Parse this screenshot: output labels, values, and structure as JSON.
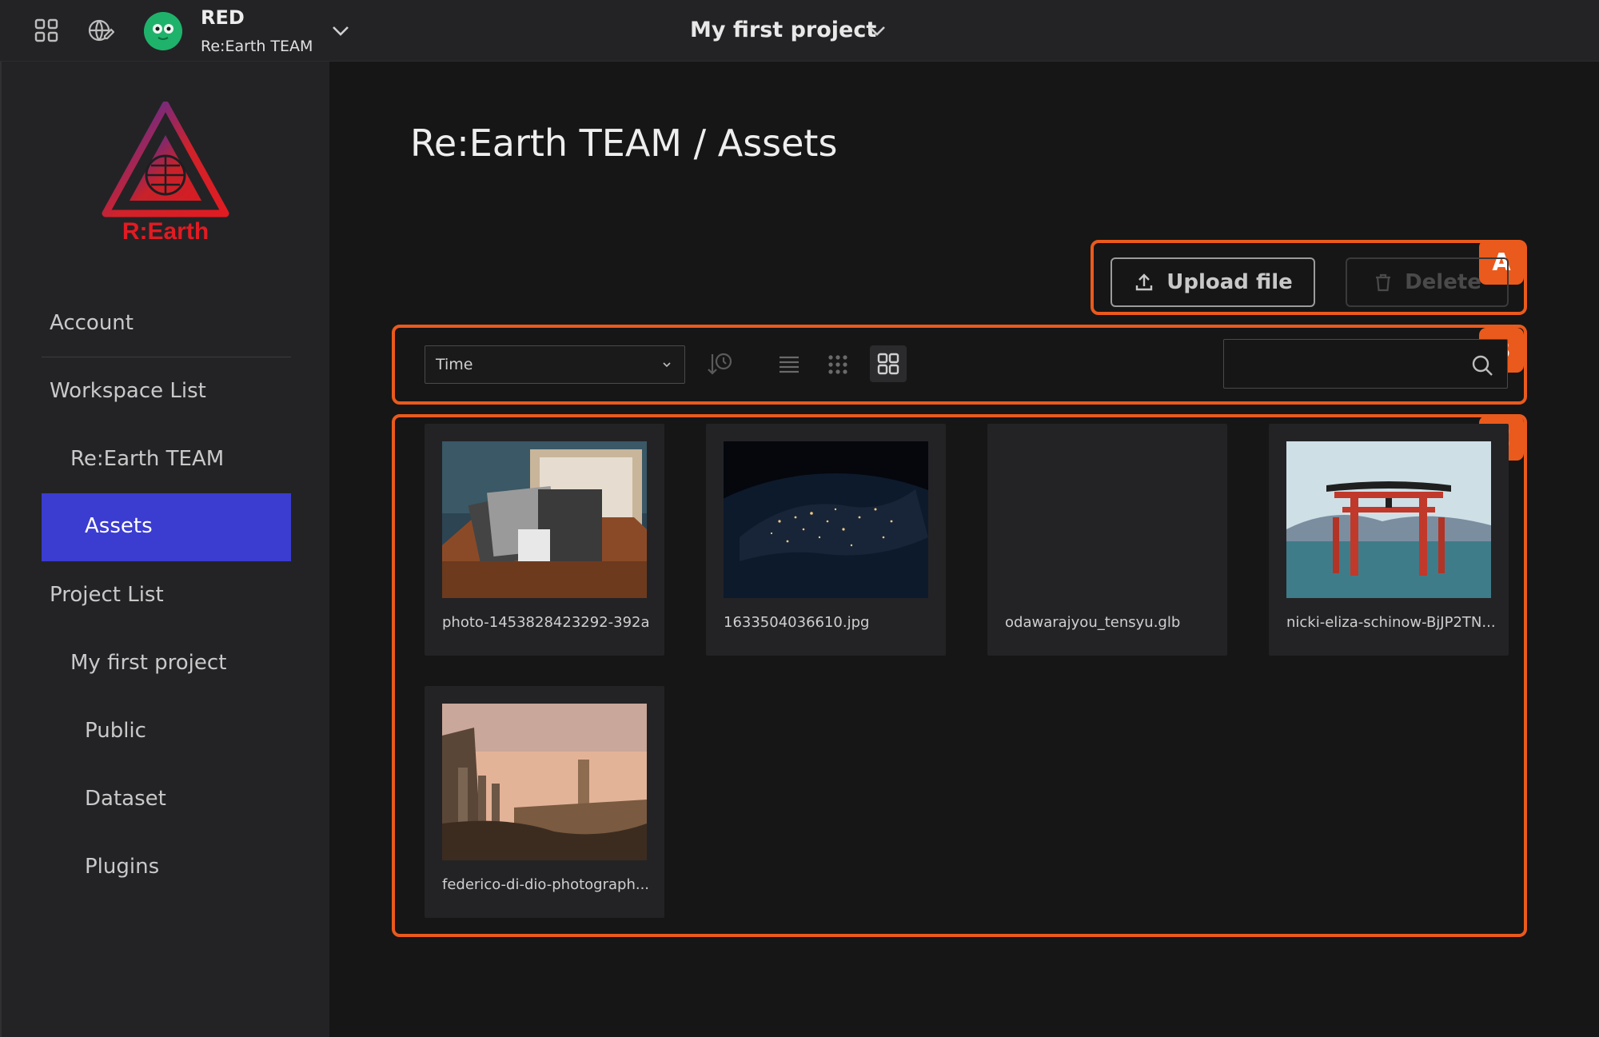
{
  "header": {
    "user_name": "RED",
    "team_name": "Re:Earth TEAM",
    "project_title": "My first project",
    "icons": [
      "dashboard-grid-icon",
      "globe-edit-icon",
      "chevron-down-icon"
    ]
  },
  "sidebar": {
    "logo_text": "R:Earth",
    "items": [
      {
        "label": "Account"
      },
      {
        "label": "Workspace List"
      },
      {
        "label": "Re:Earth TEAM"
      },
      {
        "label": "Assets",
        "active": true
      },
      {
        "label": "Project List"
      },
      {
        "label": "My first project"
      },
      {
        "label": "Public"
      },
      {
        "label": "Dataset"
      },
      {
        "label": "Plugins"
      }
    ]
  },
  "main": {
    "heading": "Re:Earth TEAM / Assets",
    "upload_label": "Upload file",
    "delete_label": "Delete",
    "sort_value": "Time",
    "search_placeholder": "",
    "callouts": [
      "A",
      "B",
      "C"
    ],
    "assets": [
      {
        "name": "photo-1453828423292-392a..."
      },
      {
        "name": "1633504036610.jpg"
      },
      {
        "name": "odawarajyou_tensyu.glb"
      },
      {
        "name": "nicki-eliza-schinow-BjJP2TN..."
      },
      {
        "name": "federico-di-dio-photograph..."
      }
    ]
  },
  "colors": {
    "accent": "#3b3cd0",
    "callout": "#ea5a1c",
    "background": "#161616",
    "panel": "#232326"
  }
}
